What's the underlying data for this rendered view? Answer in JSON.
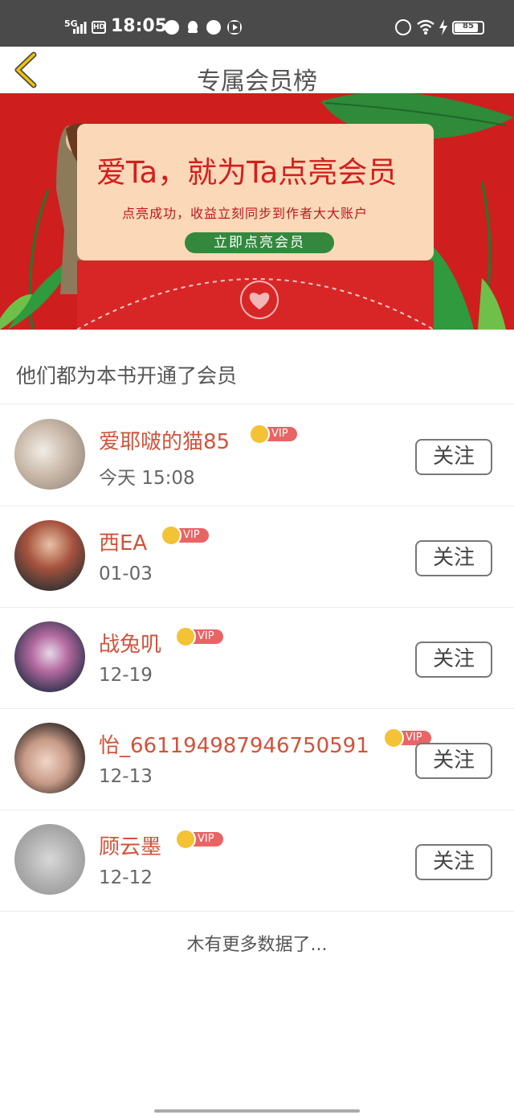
{
  "status_bar": {
    "network": "5G",
    "hd": "HD",
    "time": "18:05",
    "battery": "85",
    "battery_level": 0.85
  },
  "header": {
    "title": "专属会员榜"
  },
  "banner": {
    "headline": "爱Ta，就为Ta点亮会员",
    "subtitle": "点亮成功，收益立刻同步到作者大大账户",
    "cta": "立即点亮会员"
  },
  "section": {
    "title": "他们都为本书开通了会员"
  },
  "vip_label": "VIP",
  "follow_label": "关注",
  "members": [
    {
      "name": "爱耶啵的猫85",
      "date": "今天 15:08"
    },
    {
      "name": "西EA",
      "date": "01-03"
    },
    {
      "name": "战兔叽",
      "date": "12-19"
    },
    {
      "name": "怡_661194987946750591",
      "date": "12-13"
    },
    {
      "name": "顾云墨",
      "date": "12-12"
    }
  ],
  "footer": {
    "no_more": "木有更多数据了..."
  },
  "colors": {
    "accent": "#d2523a",
    "banner_red": "#cf1e1e",
    "vip_tag": "#e86465",
    "crown": "#f3c235",
    "cta_green": "#33883d"
  }
}
